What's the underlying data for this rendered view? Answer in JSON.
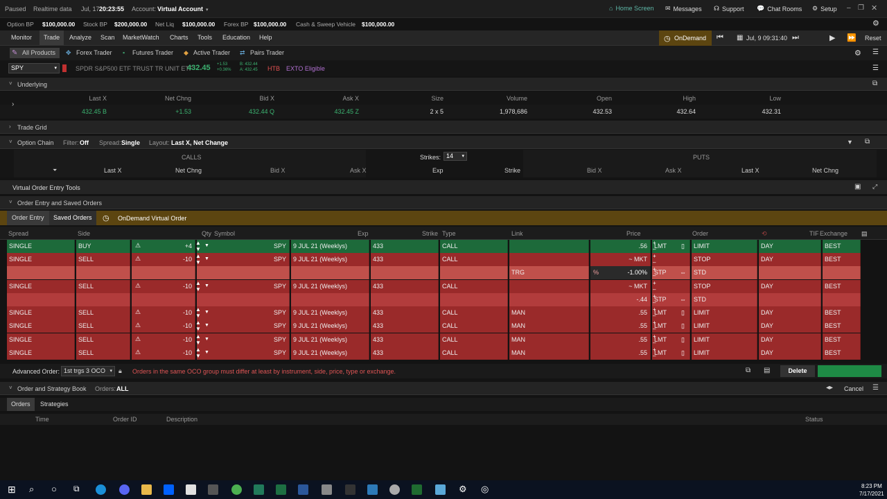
{
  "status_bar": {
    "paused": "Paused",
    "realtime": "Realtime data",
    "date": "Jul, 17",
    "time": "20:23:55",
    "account_label": "Account:",
    "account": "Virtual Account",
    "home_screen": "Home Screen",
    "messages": "Messages",
    "support": "Support",
    "chat_rooms": "Chat Rooms",
    "setup": "Setup"
  },
  "bp_bar": [
    {
      "label": "Option BP",
      "value": "$100,000.00"
    },
    {
      "label": "Stock BP",
      "value": "$200,000.00"
    },
    {
      "label": "Net Liq",
      "value": "$100,000.00"
    },
    {
      "label": "Forex BP",
      "value": "$100,000.00"
    },
    {
      "label": "Cash & Sweep Vehicle",
      "value": "$100,000.00"
    }
  ],
  "main_tabs": [
    "Monitor",
    "Trade",
    "Analyze",
    "Scan",
    "MarketWatch",
    "Charts",
    "Tools",
    "Education",
    "Help"
  ],
  "ondemand": {
    "label": "OnDemand",
    "date": "Jul, 9 09:31:40",
    "reset": "Reset"
  },
  "sub_tabs": [
    "All Products",
    "Forex Trader",
    "Futures Trader",
    "Active Trader",
    "Pairs Trader"
  ],
  "symbol": {
    "ticker": "SPY",
    "description": "SPDR S&P500 ETF TRUST TR UNIT ETF",
    "price": "432.45",
    "change": "+1.53",
    "change_pct": "+0.36%",
    "bid": "B: 432.44",
    "ask": "A: 432.45",
    "htb": "HTB",
    "exto": "EXTO Eligible"
  },
  "underlying": {
    "title": "Underlying",
    "headers": [
      "Last X",
      "Net Chng",
      "Bid X",
      "Ask X",
      "Size",
      "Volume",
      "Open",
      "High",
      "Low"
    ],
    "values": [
      "432.45 B",
      "+1.53",
      "432.44 Q",
      "432.45 Z",
      "2 x 5",
      "1,978,686",
      "432.53",
      "432.64",
      "432.31"
    ]
  },
  "trade_grid": "Trade Grid",
  "option_chain": {
    "title": "Option Chain",
    "filter_label": "Filter:",
    "filter": "Off",
    "spread_label": "Spread:",
    "spread": "Single",
    "layout_label": "Layout:",
    "layout": "Last X, Net Change",
    "calls": "CALLS",
    "puts": "PUTS",
    "strikes_label": "Strikes:",
    "strikes": "14",
    "call_cols": [
      "Last X",
      "Net Chng",
      "Bid X",
      "Ask X"
    ],
    "exp": "Exp",
    "strike": "Strike",
    "put_cols": [
      "Bid X",
      "Ask X",
      "Last X",
      "Net Chng"
    ]
  },
  "voet": "Virtual Order Entry Tools",
  "order_entry": {
    "title": "Order Entry and Saved Orders",
    "tabs": [
      "Order Entry",
      "Saved Orders"
    ],
    "ondemand_order": "OnDemand Virtual Order",
    "headers": [
      "Spread",
      "Side",
      "Qty",
      "Symbol",
      "Exp",
      "Strike",
      "Type",
      "Link",
      "Price",
      "Order",
      "TIF",
      "Exchange"
    ],
    "rows": [
      {
        "spread": "SINGLE",
        "side": "BUY",
        "qty": "+4",
        "sym": "SPY",
        "exp": "9 JUL 21 (Weeklys)",
        "strike": "433",
        "type": "CALL",
        "link": "",
        "price": ".56",
        "ptype": "LMT",
        "order": "LIMIT",
        "tif": "DAY",
        "exch": "BEST"
      },
      {
        "spread": "SINGLE",
        "side": "SELL",
        "qty": "-10",
        "sym": "SPY",
        "exp": "9 JUL 21 (Weeklys)",
        "strike": "433",
        "type": "CALL",
        "link": "",
        "price": "~ MKT",
        "ptype": "",
        "order": "STOP",
        "tif": "DAY",
        "exch": "BEST"
      },
      {
        "spread": "",
        "side": "",
        "qty": "",
        "sym": "",
        "exp": "",
        "strike": "",
        "type": "",
        "link": "TRG",
        "price": "-1.00%",
        "ptype": "STP",
        "order": "STD",
        "tif": "",
        "exch": ""
      },
      {
        "spread": "SINGLE",
        "side": "SELL",
        "qty": "-10",
        "sym": "SPY",
        "exp": "9 JUL 21 (Weeklys)",
        "strike": "433",
        "type": "CALL",
        "link": "",
        "price": "~ MKT",
        "ptype": "",
        "order": "STOP",
        "tif": "DAY",
        "exch": "BEST"
      },
      {
        "spread": "",
        "side": "",
        "qty": "",
        "sym": "",
        "exp": "",
        "strike": "",
        "type": "",
        "link": "",
        "price": "-.44",
        "ptype": "STP",
        "order": "STD",
        "tif": "",
        "exch": ""
      },
      {
        "spread": "SINGLE",
        "side": "SELL",
        "qty": "-10",
        "sym": "SPY",
        "exp": "9 JUL 21 (Weeklys)",
        "strike": "433",
        "type": "CALL",
        "link": "MAN",
        "price": ".55",
        "ptype": "LMT",
        "order": "LIMIT",
        "tif": "DAY",
        "exch": "BEST"
      },
      {
        "spread": "SINGLE",
        "side": "SELL",
        "qty": "-10",
        "sym": "SPY",
        "exp": "9 JUL 21 (Weeklys)",
        "strike": "433",
        "type": "CALL",
        "link": "MAN",
        "price": ".55",
        "ptype": "LMT",
        "order": "LIMIT",
        "tif": "DAY",
        "exch": "BEST"
      },
      {
        "spread": "SINGLE",
        "side": "SELL",
        "qty": "-10",
        "sym": "SPY",
        "exp": "9 JUL 21 (Weeklys)",
        "strike": "433",
        "type": "CALL",
        "link": "MAN",
        "price": ".55",
        "ptype": "LMT",
        "order": "LIMIT",
        "tif": "DAY",
        "exch": "BEST"
      },
      {
        "spread": "SINGLE",
        "side": "SELL",
        "qty": "-10",
        "sym": "SPY",
        "exp": "9 JUL 21 (Weeklys)",
        "strike": "433",
        "type": "CALL",
        "link": "MAN",
        "price": ".55",
        "ptype": "LMT",
        "order": "LIMIT",
        "tif": "DAY",
        "exch": "BEST"
      }
    ],
    "advanced_label": "Advanced Order:",
    "advanced_value": "1st trgs 3 OCO",
    "warning": "Orders in the same OCO group must differ at least by instrument, side, price, type or exchange.",
    "delete": "Delete"
  },
  "book": {
    "title": "Order and Strategy Book",
    "orders_label": "Orders:",
    "orders_value": "ALL",
    "tabs": [
      "Orders",
      "Strategies"
    ],
    "cols": [
      "Time",
      "Order ID",
      "Description",
      "Status"
    ],
    "cancel": "Cancel"
  },
  "taskbar": {
    "time": "8:23 PM",
    "date": "7/17/2021"
  },
  "colors": {
    "buy_row": "#1d6a3a",
    "sell_row": "#9a2a2a",
    "ondemand_gold": "#5c4510",
    "accent_green": "#3cb371"
  }
}
